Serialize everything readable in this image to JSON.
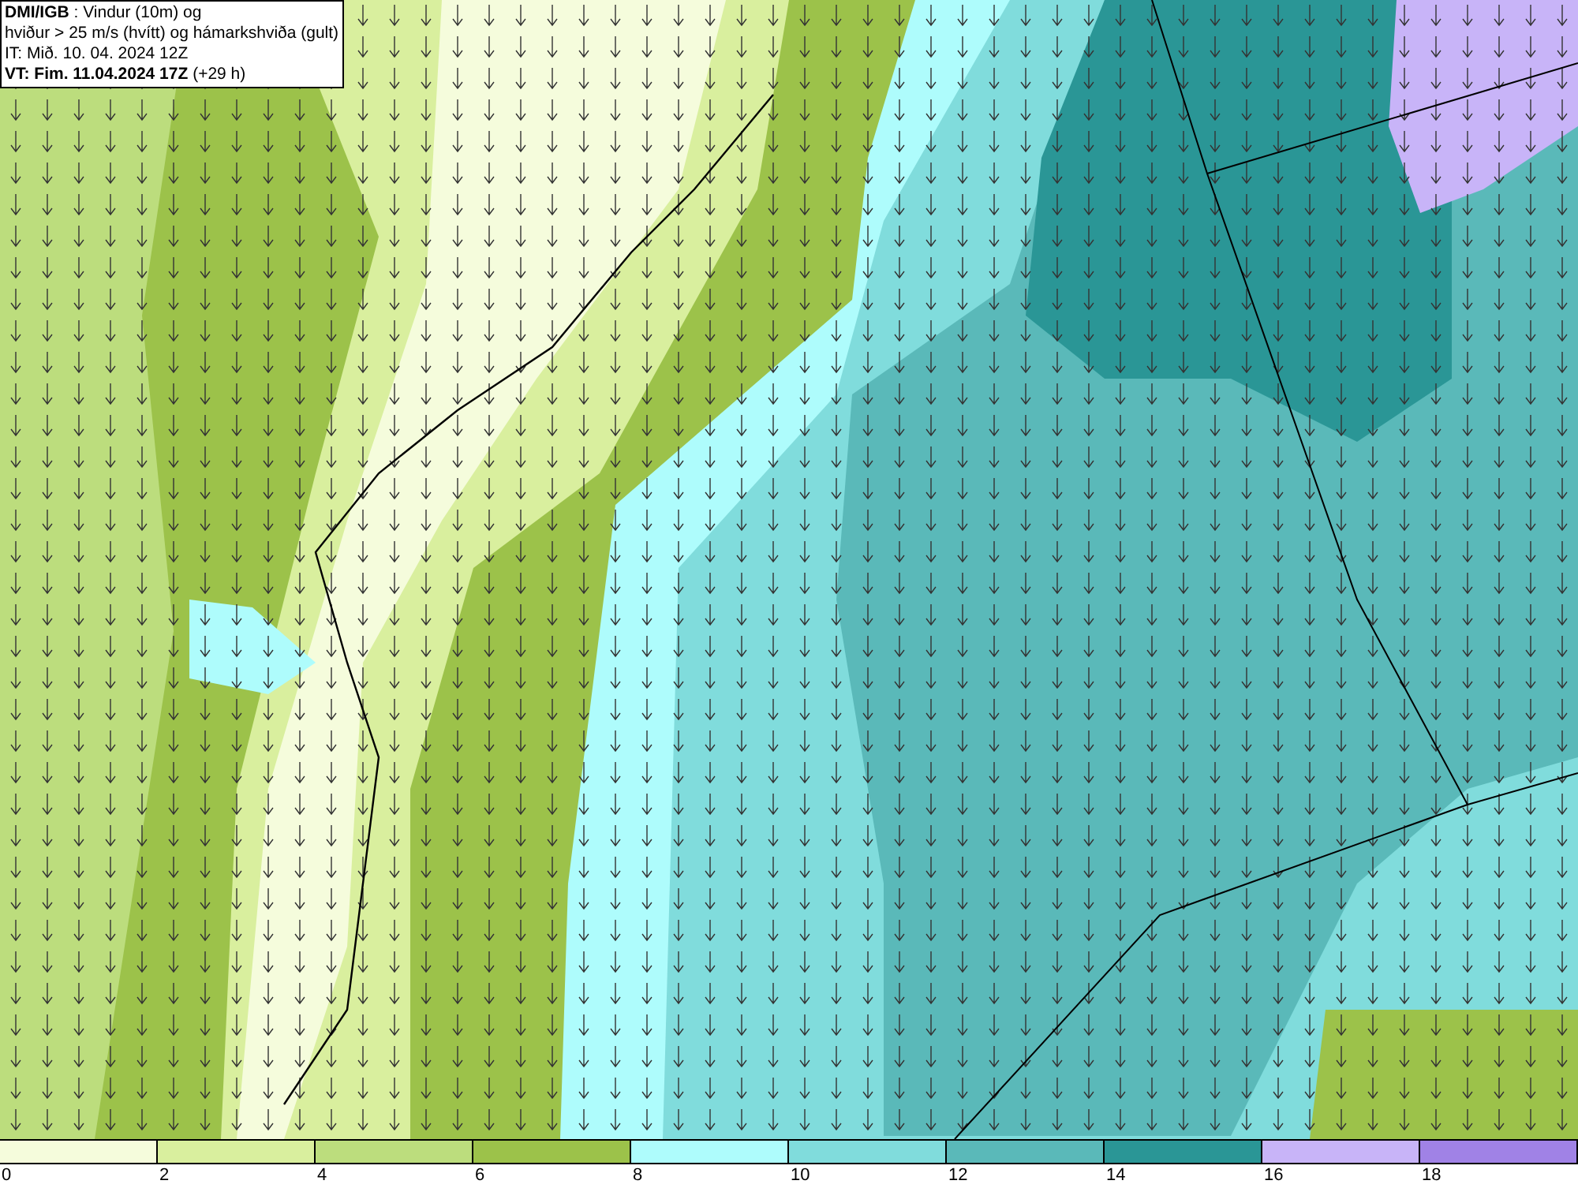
{
  "header": {
    "lines": [
      "**DMI/IGB** : Vindur (10m) og",
      "hviður > 25 m/s (hvítt) og hámarkshviða (gult)",
      "IT: Mið. 10. 04. 2024 12Z",
      "**VT: Fim. 11.04.2024 17Z** (+29 h)"
    ]
  },
  "legend": [
    {
      "label": "0",
      "color": "#f5fcdc"
    },
    {
      "label": "2",
      "color": "#d9ef9e"
    },
    {
      "label": "4",
      "color": "#bcdd7d"
    },
    {
      "label": "6",
      "color": "#9cc24a"
    },
    {
      "label": "8",
      "color": "#aefcfc"
    },
    {
      "label": "10",
      "color": "#80dcdc"
    },
    {
      "label": "12",
      "color": "#5ab9b9"
    },
    {
      "label": "14",
      "color": "#2a9696"
    },
    {
      "label": "16",
      "color": "#c8b4f8"
    },
    {
      "label": "18",
      "color": "#a082e6"
    }
  ]
}
